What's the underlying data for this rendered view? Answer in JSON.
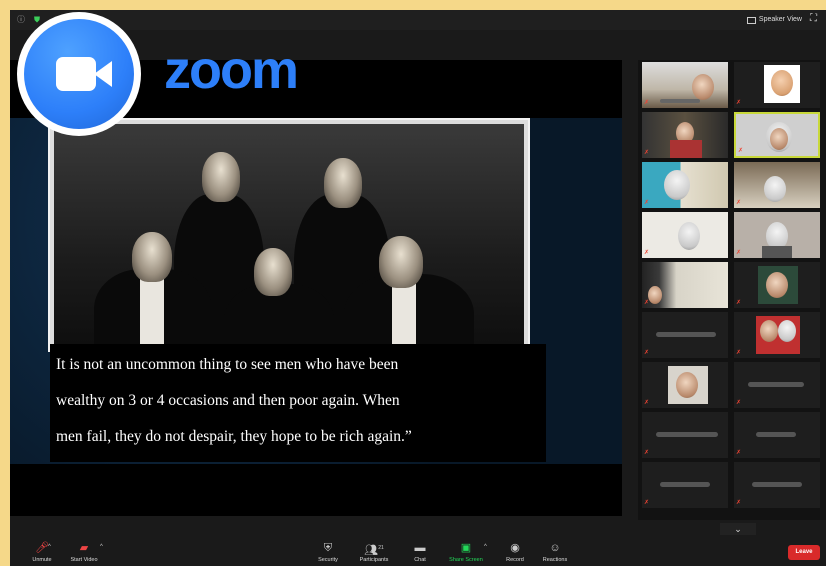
{
  "titlebar": {
    "view_label": "Speaker View"
  },
  "logo": {
    "word": "zoom"
  },
  "presentation": {
    "quote_lines": [
      "It is not an uncommon thing to see men who have been",
      "wealthy on 3 or 4 occasions and then poor again.  When",
      "men fail, they do not despair, they hope to be rich again.”"
    ]
  },
  "gallery": {
    "tile_count": 20,
    "active_tile": 4
  },
  "toolbar": {
    "unmute": "Unmute",
    "start_video": "Start Video",
    "security": "Security",
    "participants": "Participants",
    "participants_count": "21",
    "chat": "Chat",
    "share_screen": "Share Screen",
    "record": "Record",
    "reactions": "Reactions",
    "leave": "Leave"
  },
  "colors": {
    "accent": "#2d7ff9",
    "share": "#23d959",
    "leave": "#d92a2a",
    "active_border": "#c8d83a",
    "frame": "#f5d889"
  }
}
